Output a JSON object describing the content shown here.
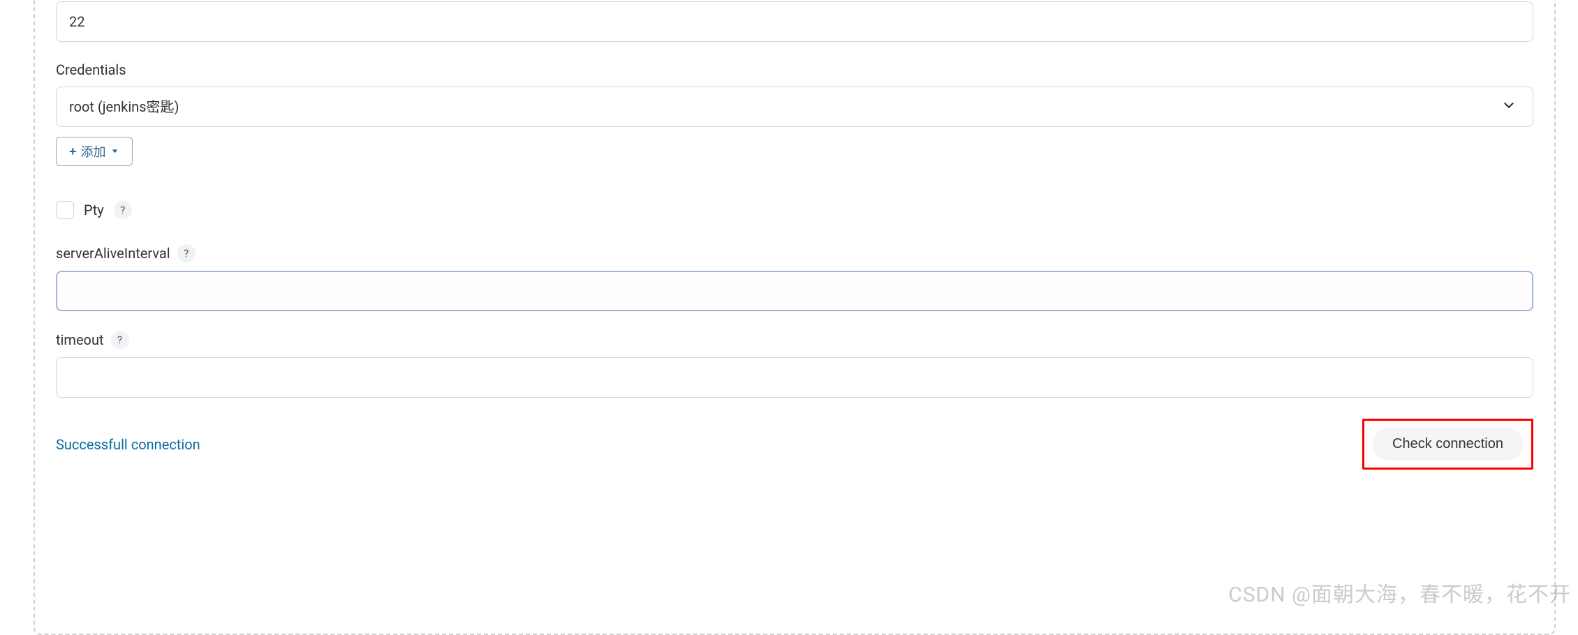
{
  "port": {
    "value": "22"
  },
  "credentials": {
    "label": "Credentials",
    "selected": "root (jenkins密匙)",
    "add_button": "添加"
  },
  "pty": {
    "label": "Pty"
  },
  "serverAliveInterval": {
    "label": "serverAliveInterval",
    "value": ""
  },
  "timeout": {
    "label": "timeout",
    "value": ""
  },
  "status": {
    "message": "Successfull connection"
  },
  "actions": {
    "check_connection": "Check connection"
  },
  "watermark": "CSDN @面朝大海，春不暖，花不开"
}
